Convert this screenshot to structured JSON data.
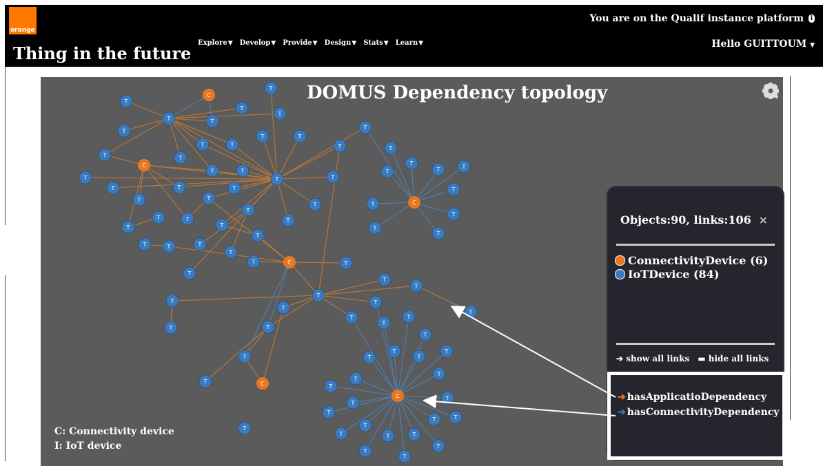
{
  "header": {
    "logo_text": "orange",
    "brand": "Thing in the future",
    "platform_notice": "You are on the Qualif instance platform",
    "greeting": "Hello GUITTOUM",
    "nav": [
      {
        "label": "Explore"
      },
      {
        "label": "Develop"
      },
      {
        "label": "Provide"
      },
      {
        "label": "Design"
      },
      {
        "label": "Stats"
      },
      {
        "label": "Learn"
      }
    ]
  },
  "graph": {
    "title": "DOMUS Dependency topology",
    "node_letter_iot": "T",
    "node_letter_connectivity": "C",
    "legend_lines": [
      "C: Connectivity device",
      "I: IoT device"
    ],
    "icons": [
      "expand-icon",
      "info-icon",
      "search-icon",
      "gear-icon"
    ]
  },
  "panel": {
    "summary": "Objects:90, links:106",
    "close": "×",
    "categories": [
      {
        "label": "ConnectivityDevice (6)",
        "color": "#e87722"
      },
      {
        "label": "IoTDevice (84)",
        "color": "#3a7bbf"
      }
    ],
    "show_all": "show all links",
    "hide_all": "hide all links",
    "link_types": [
      {
        "label": "hasApplicatioDependency",
        "color": "#e87722"
      },
      {
        "label": "hasConnectivityDependency",
        "color": "#3a7bbf"
      }
    ]
  },
  "colors": {
    "background": "#5b5b5b",
    "iot_node": "#3a7bbf",
    "connectivity_node": "#e87722",
    "app_link": "#c97a30",
    "conn_link": "#4a88c4"
  }
}
